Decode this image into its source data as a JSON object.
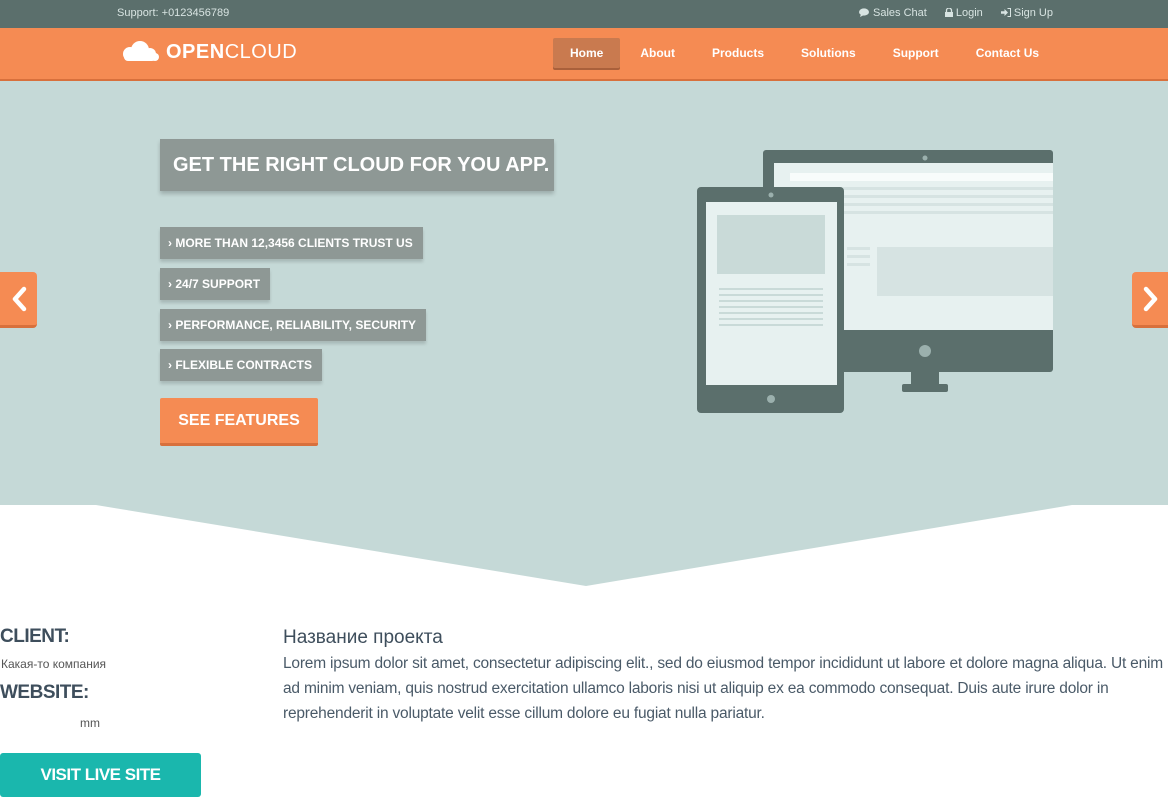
{
  "topbar": {
    "support": "Support: +0123456789",
    "sales_chat": "Sales Chat",
    "login": "Login",
    "signup": "Sign Up"
  },
  "brand": {
    "logo_bold": "OPEN",
    "logo_light": "CLOUD"
  },
  "nav": {
    "items": [
      {
        "label": "Home",
        "active": true
      },
      {
        "label": "About"
      },
      {
        "label": "Products"
      },
      {
        "label": "Solutions"
      },
      {
        "label": "Support"
      },
      {
        "label": "Contact Us"
      }
    ]
  },
  "hero": {
    "title": "GET THE RIGHT CLOUD FOR YOU APP.",
    "features": [
      "MORE THAN 12,3456 CLIENTS TRUST US",
      "24/7 SUPPORT",
      "PERFORMANCE, RELIABILITY, SECURITY",
      "FLEXIBLE CONTRACTS"
    ],
    "cta": "SEE FEATURES"
  },
  "project": {
    "client_label": "CLIENT:",
    "client_value": "Какая-то компания",
    "website_label": "WEBSITE:",
    "website_value": "mm",
    "visit_button": "VISIT LIVE SITE",
    "title": "Название проекта",
    "description": "Lorem ipsum dolor sit amet, consectetur adipiscing elit., sed do eiusmod tempor incididunt ut labore et dolore magna aliqua. Ut enim ad minim veniam, quis nostrud exercitation ullamco laboris nisi ut aliquip ex ea commodo consequat. Duis aute irure dolor in reprehenderit in voluptate velit esse cillum dolore eu fugiat nulla pariatur."
  },
  "icons": {
    "sales_chat": "chat-icon",
    "login": "lock-icon",
    "signup": "sign-in-icon",
    "logo": "cloud-icon",
    "prev": "chevron-left-icon",
    "next": "chevron-right-icon"
  },
  "colors": {
    "topbar": "#5b6f6c",
    "accent_orange": "#f58b53",
    "hero_bg": "#c5d9d7",
    "feature_box": "#8e9895",
    "visit_button": "#1ab7ad",
    "device": "#5b6f6c"
  }
}
